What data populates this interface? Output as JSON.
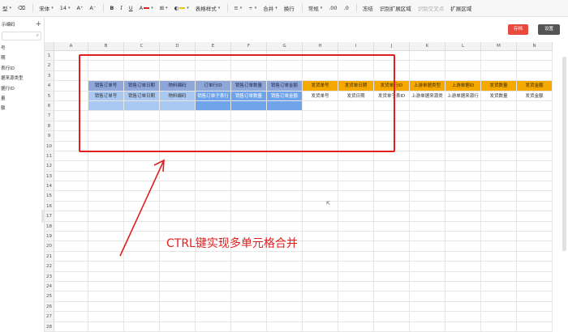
{
  "toolbar": {
    "items": [
      {
        "label": "型",
        "name": "template-type-dropdown"
      },
      {
        "label": "⌫",
        "name": "eraser-icon"
      },
      {
        "label": "宋体",
        "name": "font-family-select"
      },
      {
        "label": "14",
        "name": "font-size-select"
      },
      {
        "label": "A⁺",
        "name": "increase-font-icon"
      },
      {
        "label": "A⁻",
        "name": "decrease-font-icon"
      },
      {
        "label": "B",
        "name": "bold-button"
      },
      {
        "label": "I",
        "name": "italic-button"
      },
      {
        "label": "U",
        "name": "underline-button"
      },
      {
        "label": "A",
        "name": "font-color-button"
      },
      {
        "label": "⊞",
        "name": "border-button"
      },
      {
        "label": "◐",
        "name": "fill-color-button"
      },
      {
        "label": "表格样式",
        "name": "table-style-dropdown"
      },
      {
        "label": "≡",
        "name": "align-button"
      },
      {
        "label": "÷",
        "name": "valign-button"
      },
      {
        "label": "合并",
        "name": "merge-button"
      },
      {
        "label": "换行",
        "name": "wrap-button"
      },
      {
        "label": "常规",
        "name": "number-format-select"
      },
      {
        "label": ".00",
        "name": "decimal-button"
      },
      {
        "label": ".0",
        "name": "decimal-reduce-button"
      },
      {
        "label": "冻结",
        "name": "freeze-button"
      },
      {
        "label": "识别扩展区域",
        "name": "detect-area-button"
      },
      {
        "label": "识别交叉点",
        "name": "detect-cross-button"
      },
      {
        "label": "扩展区域",
        "name": "expand-area-button"
      }
    ],
    "font_color": "#e02020",
    "fill_color": "#f5c400"
  },
  "sidebar": {
    "header": "示编码",
    "plus": "+",
    "items": [
      "号",
      "期",
      "表行ID",
      "据来源类型",
      "据行ID",
      "量",
      "额"
    ]
  },
  "buttons": {
    "save": "存档",
    "settings": "设置"
  },
  "columns": [
    "A",
    "B",
    "C",
    "D",
    "E",
    "F",
    "G",
    "H",
    "I",
    "J",
    "K",
    "L",
    "M",
    "N"
  ],
  "rows": {
    "4": [
      "",
      "销售订单号",
      "销售订单日期",
      "物料编码",
      "订单行ID",
      "销售订单数量",
      "销售订单金额",
      "发货单号",
      "发货单日期",
      "发货单行ID",
      "上游单据类型",
      "上游单据ID",
      "发货数量",
      "发货金额"
    ],
    "5": [
      "",
      "销售订单号",
      "销售订单日期",
      "物料编码",
      "销售订单子表行",
      "销售订单数量",
      "销售订单金额",
      "发货单号",
      "发货日期",
      "发货单子表ID",
      "上游单据来源类",
      "上游单据来源行",
      "发货数量",
      "发货金额"
    ]
  },
  "row_count": 28,
  "caption": "CTRL键实现多单元格合并",
  "colors": {
    "blue_header": "#8fa6d9",
    "orange_header": "#f5a800",
    "blue_cell": "#a9c9f2",
    "highlight": "#e02020"
  }
}
